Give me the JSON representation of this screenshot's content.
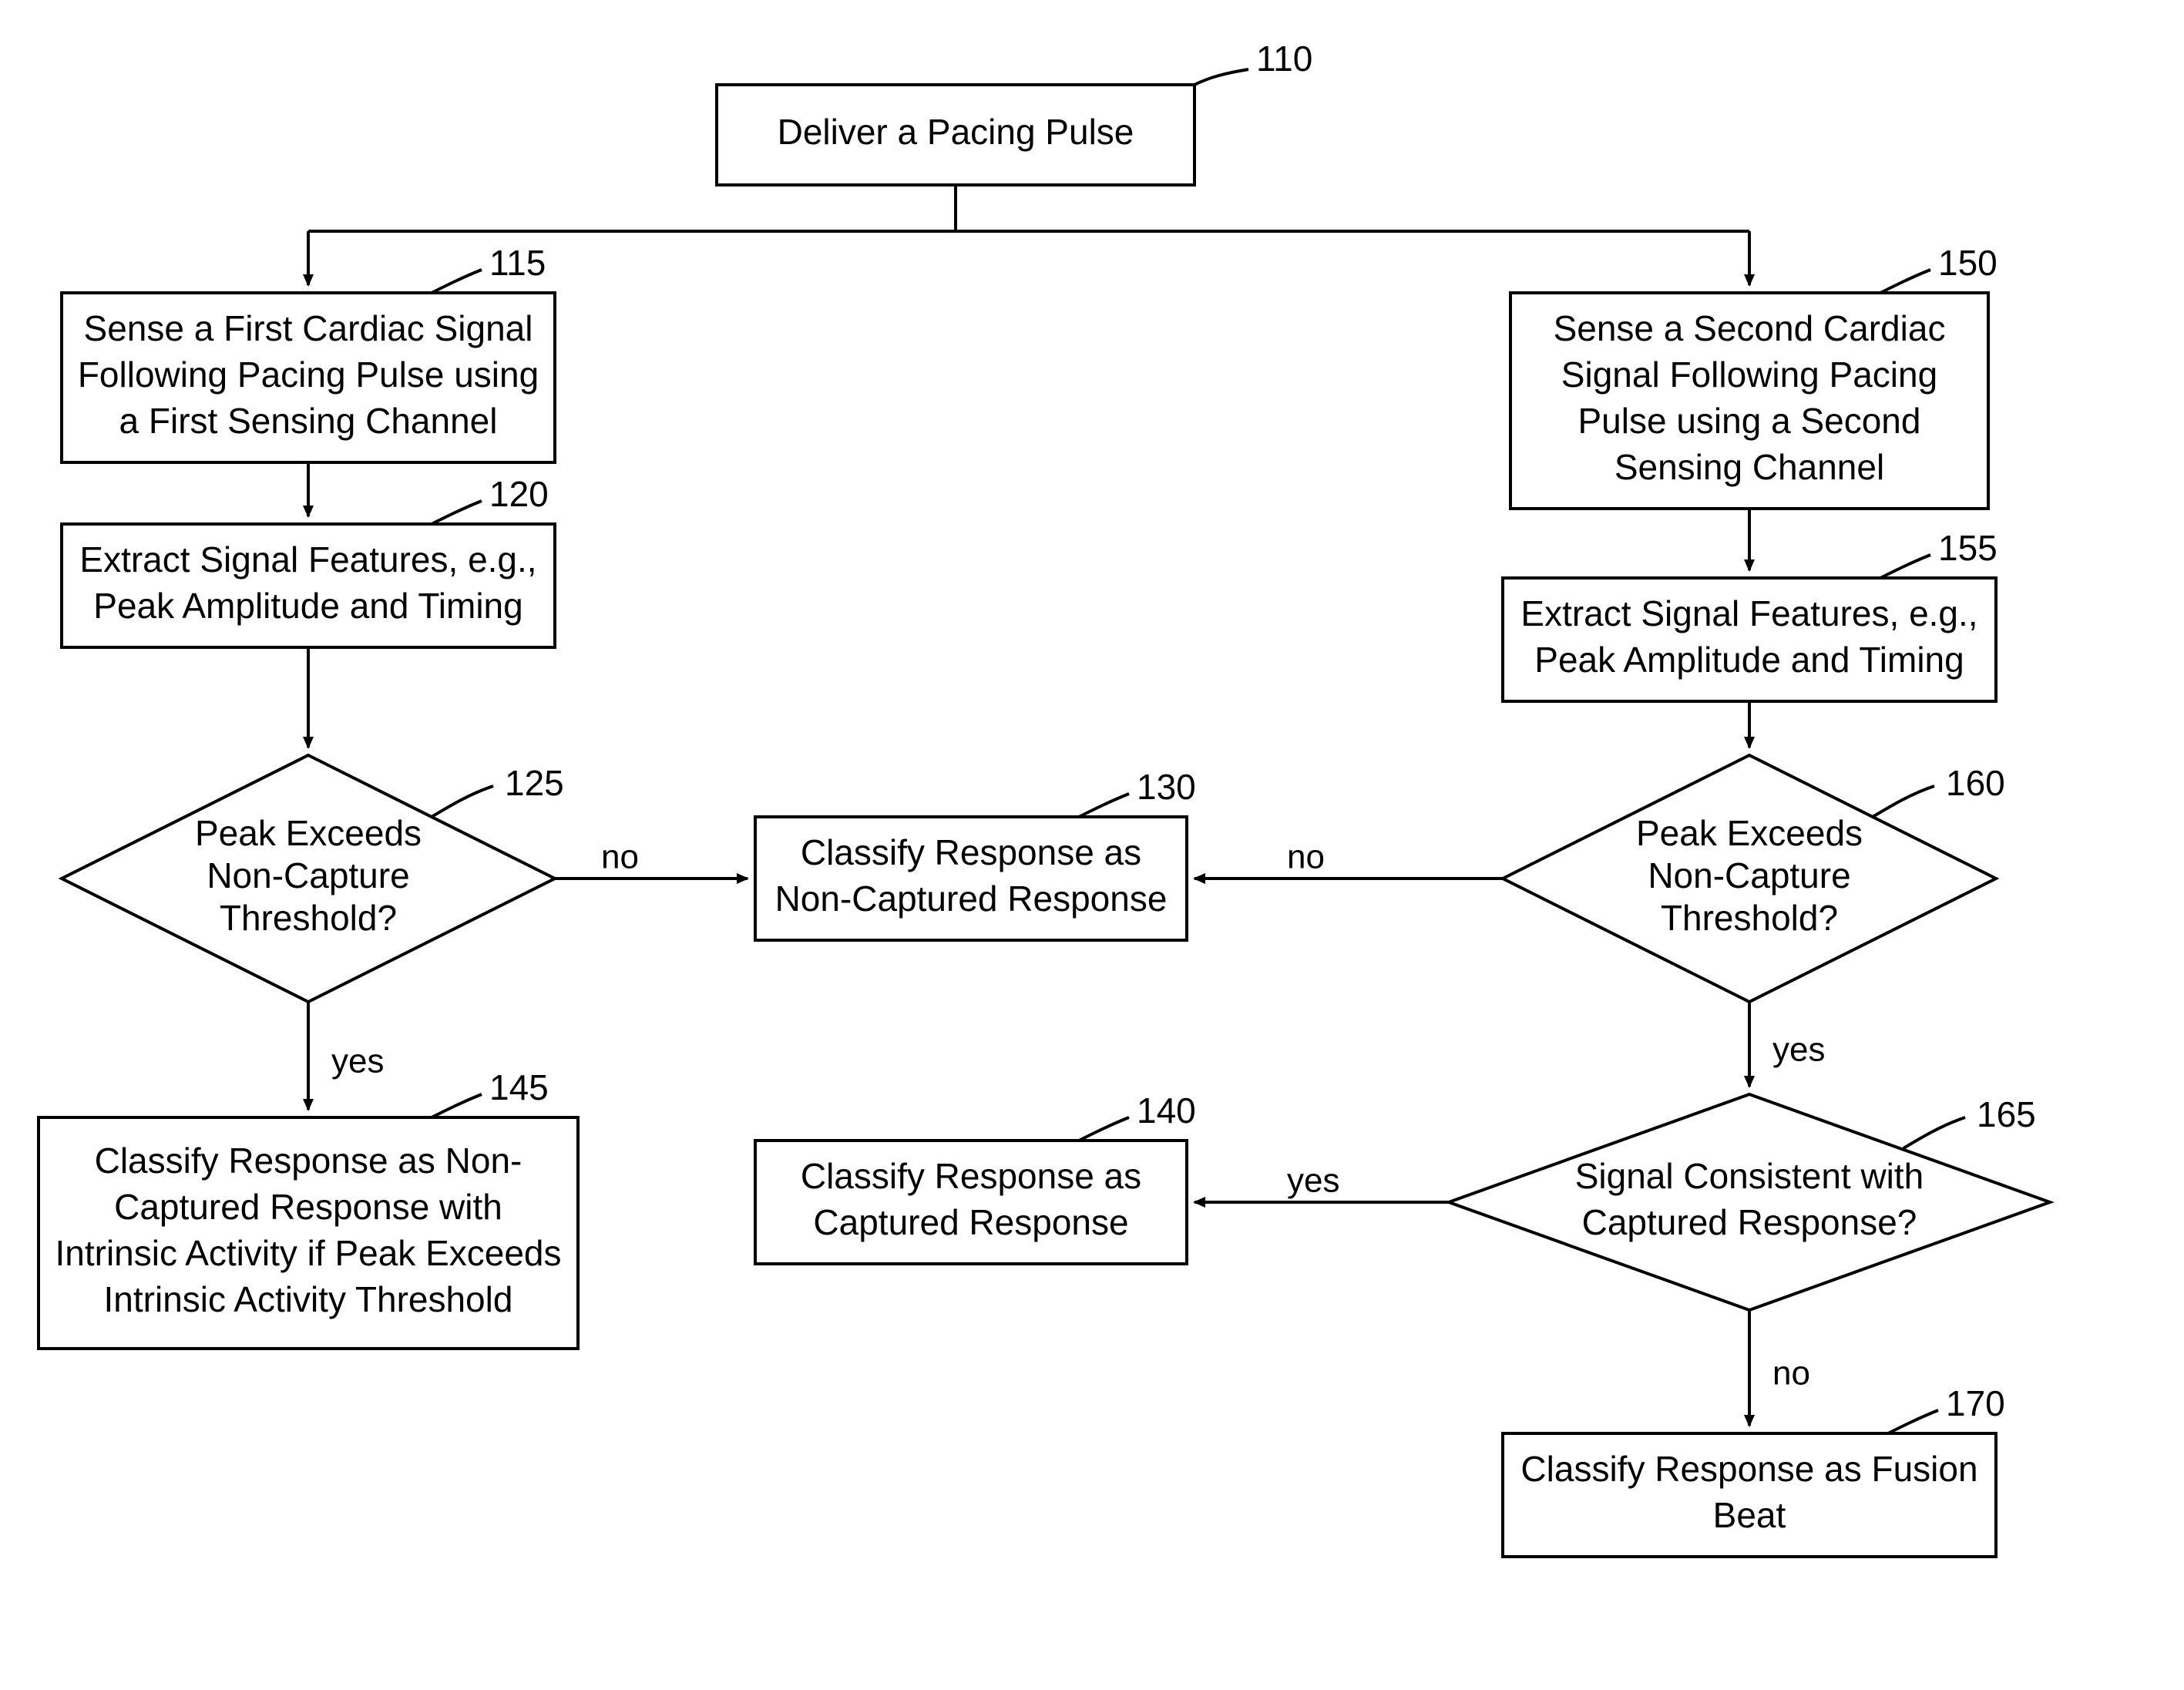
{
  "nodes": {
    "n110": {
      "ref": "110",
      "text": [
        "Deliver a Pacing Pulse"
      ]
    },
    "n115": {
      "ref": "115",
      "text": [
        "Sense a First Cardiac Signal",
        "Following Pacing Pulse using",
        "a First Sensing Channel"
      ]
    },
    "n120": {
      "ref": "120",
      "text": [
        "Extract Signal Features, e.g.,",
        "Peak Amplitude and Timing"
      ]
    },
    "n125": {
      "ref": "125",
      "text": [
        "Peak Exceeds",
        "Non-Capture",
        "Threshold?"
      ]
    },
    "n130": {
      "ref": "130",
      "text": [
        "Classify Response as",
        "Non-Captured Response"
      ]
    },
    "n140": {
      "ref": "140",
      "text": [
        "Classify Response as",
        "Captured Response"
      ]
    },
    "n145": {
      "ref": "145",
      "text": [
        "Classify Response as Non-",
        "Captured Response with",
        "Intrinsic Activity if Peak Exceeds",
        "Intrinsic Activity Threshold"
      ]
    },
    "n150": {
      "ref": "150",
      "text": [
        "Sense a Second Cardiac",
        "Signal Following Pacing",
        "Pulse using a Second",
        "Sensing Channel"
      ]
    },
    "n155": {
      "ref": "155",
      "text": [
        "Extract Signal Features, e.g.,",
        "Peak Amplitude and Timing"
      ]
    },
    "n160": {
      "ref": "160",
      "text": [
        "Peak Exceeds",
        "Non-Capture",
        "Threshold?"
      ]
    },
    "n165": {
      "ref": "165",
      "text": [
        "Signal Consistent with",
        "Captured Response?"
      ]
    },
    "n170": {
      "ref": "170",
      "text": [
        "Classify Response as Fusion",
        "Beat"
      ]
    }
  },
  "edges": {
    "e125no": "no",
    "e125yes": "yes",
    "e160no": "no",
    "e160yes": "yes",
    "e165yes": "yes",
    "e165no": "no"
  }
}
